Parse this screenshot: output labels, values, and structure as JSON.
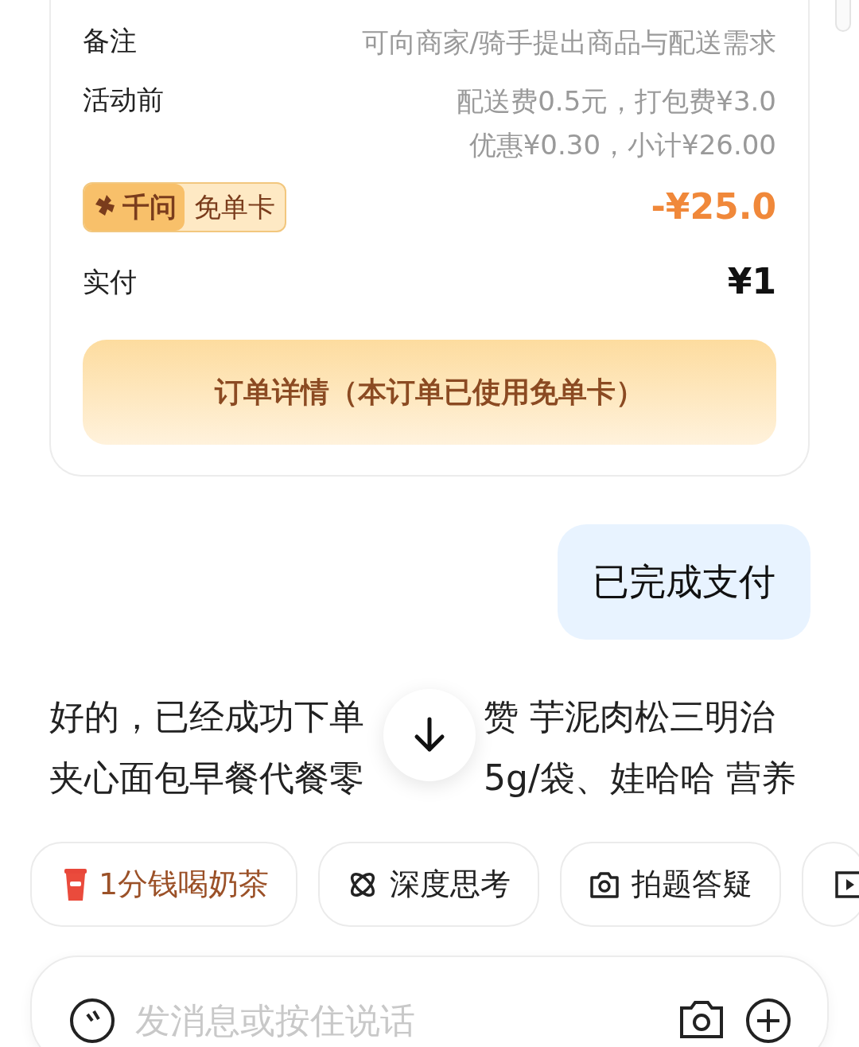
{
  "order_card": {
    "rows": [
      {
        "kind": "text",
        "label": "备注",
        "value_lines": [
          "可向商家/骑手提出商品与配送需求"
        ]
      },
      {
        "kind": "text",
        "label": "活动前",
        "value_lines": [
          "配送费0.5元，打包费¥3.0",
          "优惠¥0.30，小计¥26.00"
        ]
      },
      {
        "kind": "badge",
        "badge_brand": "千问",
        "badge_label": "免单卡",
        "value": "-¥25.0"
      },
      {
        "kind": "total",
        "label": "实付",
        "value": "¥1"
      }
    ],
    "detail_button": "订单详情（本订单已使用免单卡）"
  },
  "user_message": "已完成支付",
  "assistant_message": {
    "lines": [
      [
        "好的，已经成功下单",
        "赞 芋泥肉松三明治"
      ],
      [
        "夹心面包早餐代餐零",
        "5g/袋、娃哈哈 营养"
      ]
    ]
  },
  "chips": [
    {
      "kind": "promo",
      "label": "1分钱喝奶茶"
    },
    {
      "kind": "think",
      "label": "深度思考"
    },
    {
      "kind": "photo",
      "label": "拍题答疑"
    },
    {
      "kind": "video"
    }
  ],
  "input": {
    "placeholder": "发消息或按住说话"
  }
}
